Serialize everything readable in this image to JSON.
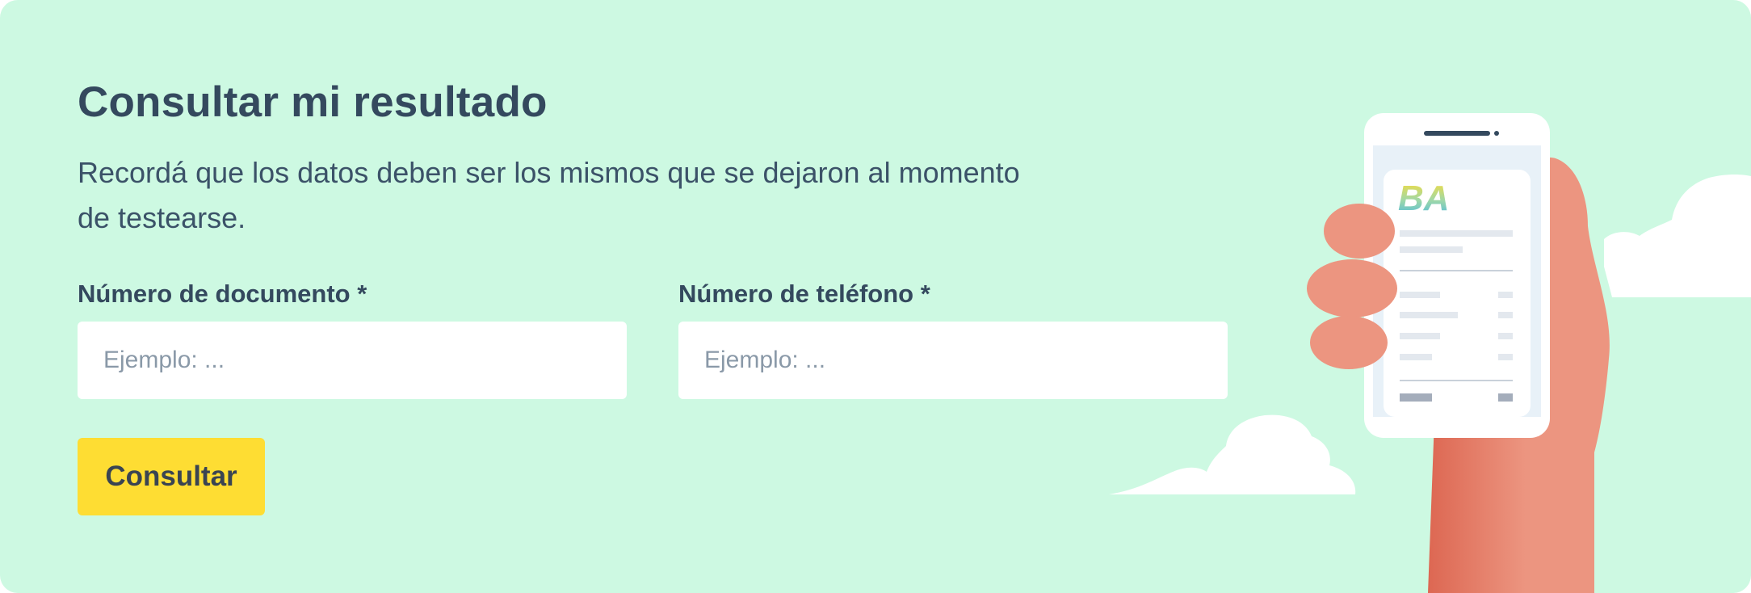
{
  "form": {
    "title": "Consultar mi resultado",
    "description": "Recordá que los datos deben ser los mismos que se dejaron al momento de testearse.",
    "fields": [
      {
        "label": "Número de documento *",
        "placeholder": "Ejemplo: ...",
        "value": ""
      },
      {
        "label": "Número de teléfono *",
        "placeholder": "Ejemplo: ...",
        "value": ""
      }
    ],
    "submit_label": "Consultar"
  },
  "illustration": {
    "logo_text": "BA"
  },
  "colors": {
    "background": "#cdf9e2",
    "heading": "#34495e",
    "button": "#fedd33",
    "button_text": "#3a4452",
    "input_background": "#ffffff",
    "placeholder": "#8a99a8",
    "hand": "#ec9580"
  }
}
